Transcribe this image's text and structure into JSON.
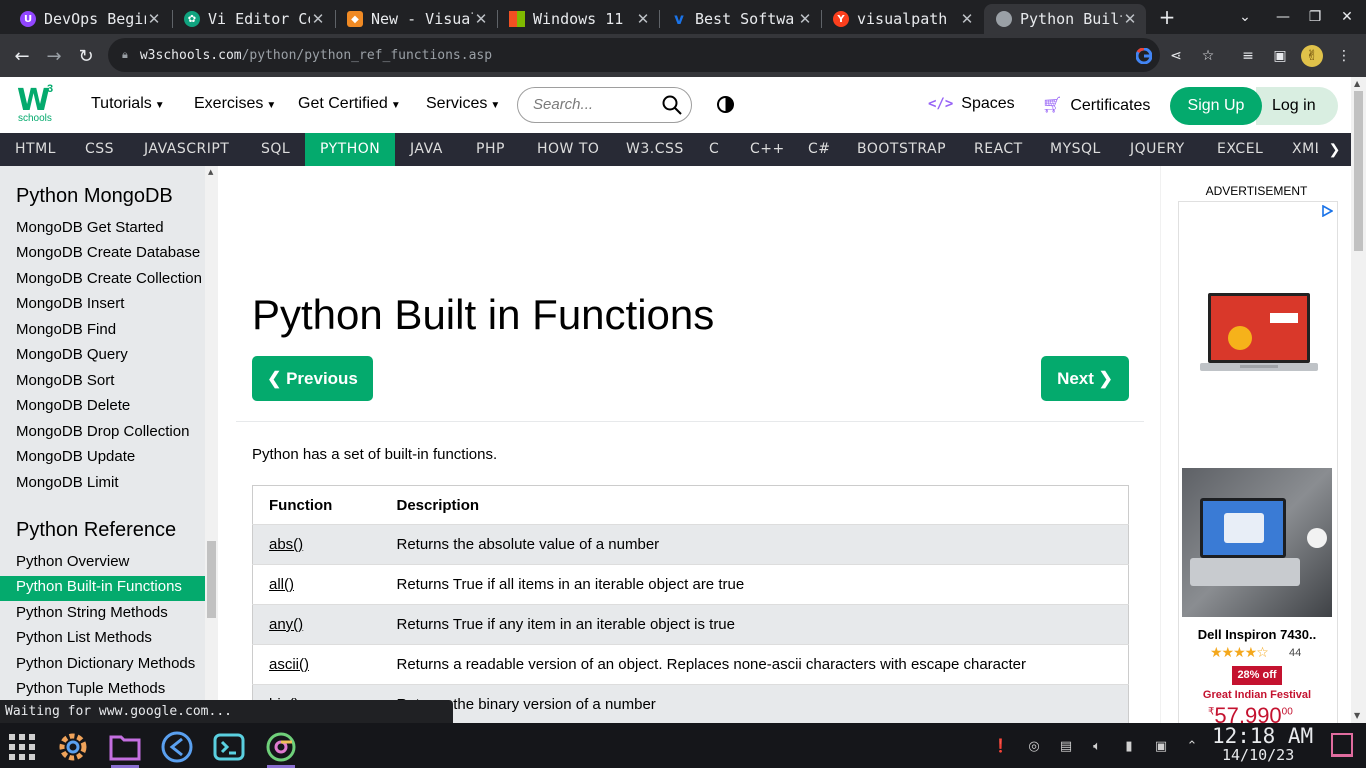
{
  "browser": {
    "tabs": [
      {
        "title": "DevOps Beginners",
        "favicon": "twitch-icon",
        "color": "#9146ff",
        "active": false
      },
      {
        "title": "Vi Editor Commands",
        "favicon": "chatgpt-icon",
        "color": "#10a37f",
        "active": false
      },
      {
        "title": "New - Visual Paradigm",
        "favicon": "cube-icon",
        "color": "#f08a24",
        "active": false
      },
      {
        "title": "Windows 11",
        "favicon": "windows-icon",
        "color": "#0078d4",
        "active": false
      },
      {
        "title": "Best Software",
        "favicon": "v-icon",
        "color": "#1a73e8",
        "active": false
      },
      {
        "title": "visualpath",
        "favicon": "yandex-icon",
        "color": "#fc3f1d",
        "active": false
      },
      {
        "title": "Python Built-in Functions",
        "favicon": "globe-icon",
        "color": "#9aa0a6",
        "active": true
      }
    ],
    "url_host": "w3schools.com",
    "url_path": "/python/python_ref_functions.asp",
    "status_text": "Waiting for www.google.com..."
  },
  "topnav": {
    "menu": [
      "Tutorials",
      "Exercises",
      "Get Certified",
      "Services"
    ],
    "search_placeholder": "Search...",
    "spaces": "Spaces",
    "certificates": "Certificates",
    "signup": "Sign Up",
    "login": "Log in",
    "logo_sup": "3",
    "logo_sub": "schools"
  },
  "langbar": {
    "items": [
      "HTML",
      "CSS",
      "JAVASCRIPT",
      "SQL",
      "PYTHON",
      "JAVA",
      "PHP",
      "HOW TO",
      "W3.CSS",
      "C",
      "C++",
      "C#",
      "BOOTSTRAP",
      "REACT",
      "MYSQL",
      "JQUERY",
      "EXCEL",
      "XML"
    ],
    "active": "PYTHON"
  },
  "sidebar": {
    "section1_title": "Python MongoDB",
    "section1_items": [
      "MongoDB Get Started",
      "MongoDB Create Database",
      "MongoDB Create Collection",
      "MongoDB Insert",
      "MongoDB Find",
      "MongoDB Query",
      "MongoDB Sort",
      "MongoDB Delete",
      "MongoDB Drop Collection",
      "MongoDB Update",
      "MongoDB Limit"
    ],
    "section2_title": "Python Reference",
    "section2_items": [
      "Python Overview",
      "Python Built-in Functions",
      "Python String Methods",
      "Python List Methods",
      "Python Dictionary Methods",
      "Python Tuple Methods"
    ],
    "active_item": "Python Built-in Functions"
  },
  "main": {
    "title": "Python Built in Functions",
    "prev_label": "❮ Previous",
    "next_label": "Next ❯",
    "intro": "Python has a set of built-in functions.",
    "table_headers": [
      "Function",
      "Description"
    ],
    "table_rows": [
      {
        "fn": "abs()",
        "desc": "Returns the absolute value of a number"
      },
      {
        "fn": "all()",
        "desc": "Returns True if all items in an iterable object are true"
      },
      {
        "fn": "any()",
        "desc": "Returns True if any item in an iterable object is true"
      },
      {
        "fn": "ascii()",
        "desc": "Returns a readable version of an object. Replaces none-ascii characters with escape character"
      },
      {
        "fn": "bin()",
        "desc": "Returns the binary version of a number"
      }
    ]
  },
  "ad": {
    "label": "ADVERTISEMENT",
    "product": "Dell Inspiron 7430..",
    "rating_stars": 4,
    "rating_count": "44",
    "discount": "28% off",
    "festival": "Great Indian Festival",
    "price_symbol": "₹",
    "price": "57,990",
    "price_cents": "00"
  },
  "taskbar": {
    "time": "12:18 AM",
    "date": "14/10/23"
  },
  "colors": {
    "brand": "#04aa6d",
    "langbar": "#282a35",
    "sidebar": "#e7e9eb",
    "price": "#c4122f"
  }
}
